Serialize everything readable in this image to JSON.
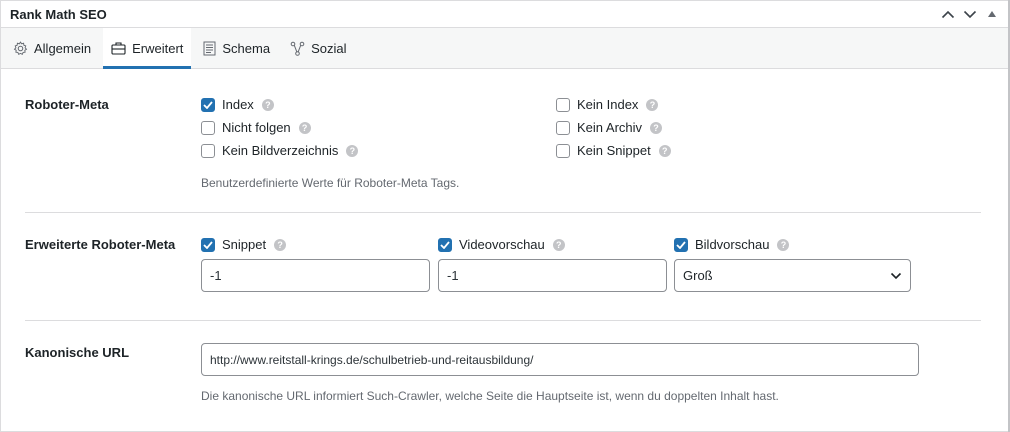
{
  "panel": {
    "title": "Rank Math SEO"
  },
  "tabs": [
    {
      "label": "Allgemein",
      "icon": "gear-icon"
    },
    {
      "label": "Erweitert",
      "icon": "toolbox-icon",
      "active": true
    },
    {
      "label": "Schema",
      "icon": "schema-icon"
    },
    {
      "label": "Sozial",
      "icon": "share-icon"
    }
  ],
  "robots": {
    "label": "Roboter-Meta",
    "options": {
      "index": {
        "label": "Index",
        "checked": true
      },
      "nofollow": {
        "label": "Nicht folgen",
        "checked": false
      },
      "noimageindex": {
        "label": "Kein Bildverzeichnis",
        "checked": false
      },
      "noindex": {
        "label": "Kein Index",
        "checked": false
      },
      "noarchive": {
        "label": "Kein Archiv",
        "checked": false
      },
      "nosnippet": {
        "label": "Kein Snippet",
        "checked": false
      }
    },
    "description": "Benutzerdefinierte Werte für Roboter-Meta Tags."
  },
  "advanced_robots": {
    "label": "Erweiterte Roboter-Meta",
    "snippet": {
      "label": "Snippet",
      "checked": true,
      "value": "-1"
    },
    "video": {
      "label": "Videovorschau",
      "checked": true,
      "value": "-1"
    },
    "image": {
      "label": "Bildvorschau",
      "checked": true,
      "value": "Groß"
    }
  },
  "canonical": {
    "label": "Kanonische URL",
    "value": "http://www.reitstall-krings.de/schulbetrieb-und-reitausbildung/",
    "description": "Die kanonische URL informiert Such-Crawler, welche Seite die Hauptseite ist, wenn du doppelten Inhalt hast."
  },
  "help_glyph": "?",
  "colors": {
    "accent": "#2271b1",
    "help": "#c3c4c7"
  }
}
